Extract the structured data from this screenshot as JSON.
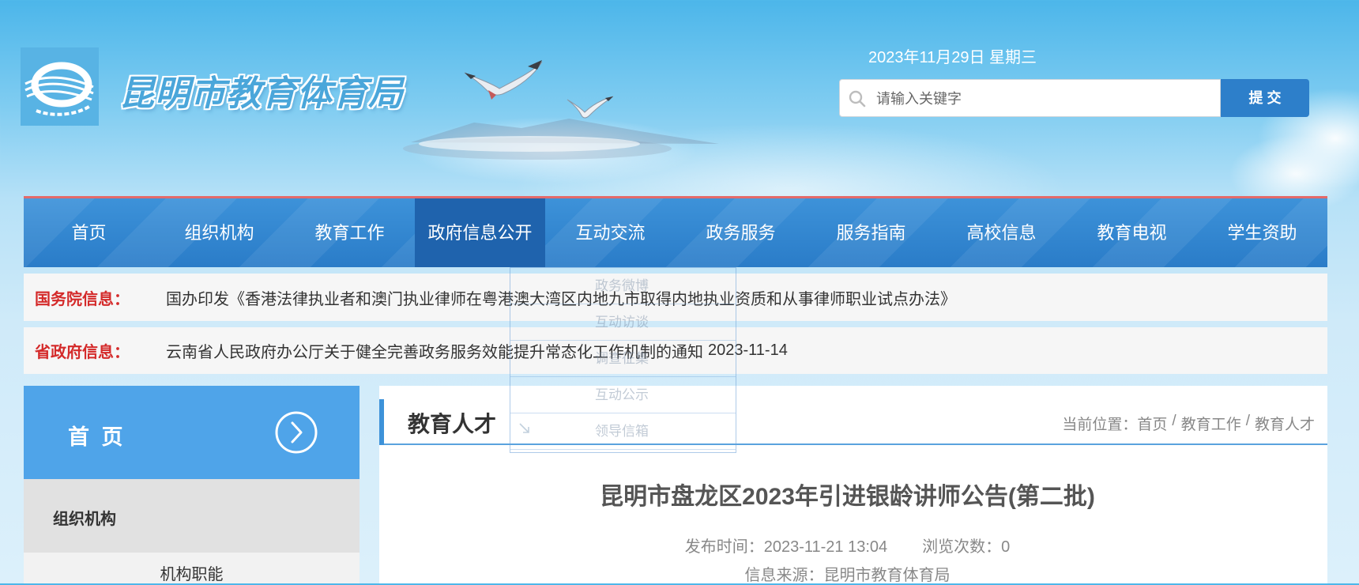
{
  "header": {
    "logo_text": "昆明市教育体育局",
    "logo_icon": "bureau-emblem-icon",
    "date": "2023年11月29日 星期三",
    "search_placeholder": "请输入关键字",
    "search_value": "",
    "submit_label": "提 交"
  },
  "nav": {
    "items": [
      "首页",
      "组织机构",
      "教育工作",
      "政府信息公开",
      "互动交流",
      "政务服务",
      "服务指南",
      "高校信息",
      "教育电视",
      "学生资助"
    ],
    "dropdown": [
      "政务微博",
      "互动访谈",
      "调查征集",
      "互动公示",
      "领导信箱"
    ]
  },
  "notices": [
    {
      "label": "国务院信息：",
      "text": "国办印发《香港法律执业者和澳门执业律师在粤港澳大湾区内地九市取得内地执业资质和从事律师职业试点办法》"
    },
    {
      "label": "省政府信息：",
      "text": "云南省人民政府办公厅关于健全完善政务服务效能提升常态化工作机制的通知",
      "date": "2023-11-14"
    }
  ],
  "sidebar": {
    "home_label": "首 页",
    "section_label": "组织机构",
    "items": [
      "机构职能"
    ]
  },
  "content": {
    "column_title": "教育人才",
    "breadcrumb_prefix": "当前位置：",
    "breadcrumb": [
      "首页",
      "教育工作",
      "教育人才"
    ],
    "breadcrumb_sep": "/",
    "article_title": "昆明市盘龙区2023年引进银龄讲师公告(第二批)",
    "publish_label": "发布时间：",
    "publish_time": "2023-11-21 13:04",
    "views_label": "浏览次数：",
    "views": "0",
    "source_label": "信息来源：",
    "source": "昆明市教育体育局"
  },
  "colors": {
    "nav_blue": "#2a7cc8",
    "nav_active": "#1f63ad",
    "submit_blue": "#2d7fca",
    "notice_label_red": "#d42a2a",
    "sidebar_header": "#4fa4e9"
  },
  "icons": [
    "bureau-emblem-icon",
    "search-icon",
    "circle-chevron-right-icon",
    "arrow-down-right-icon"
  ]
}
